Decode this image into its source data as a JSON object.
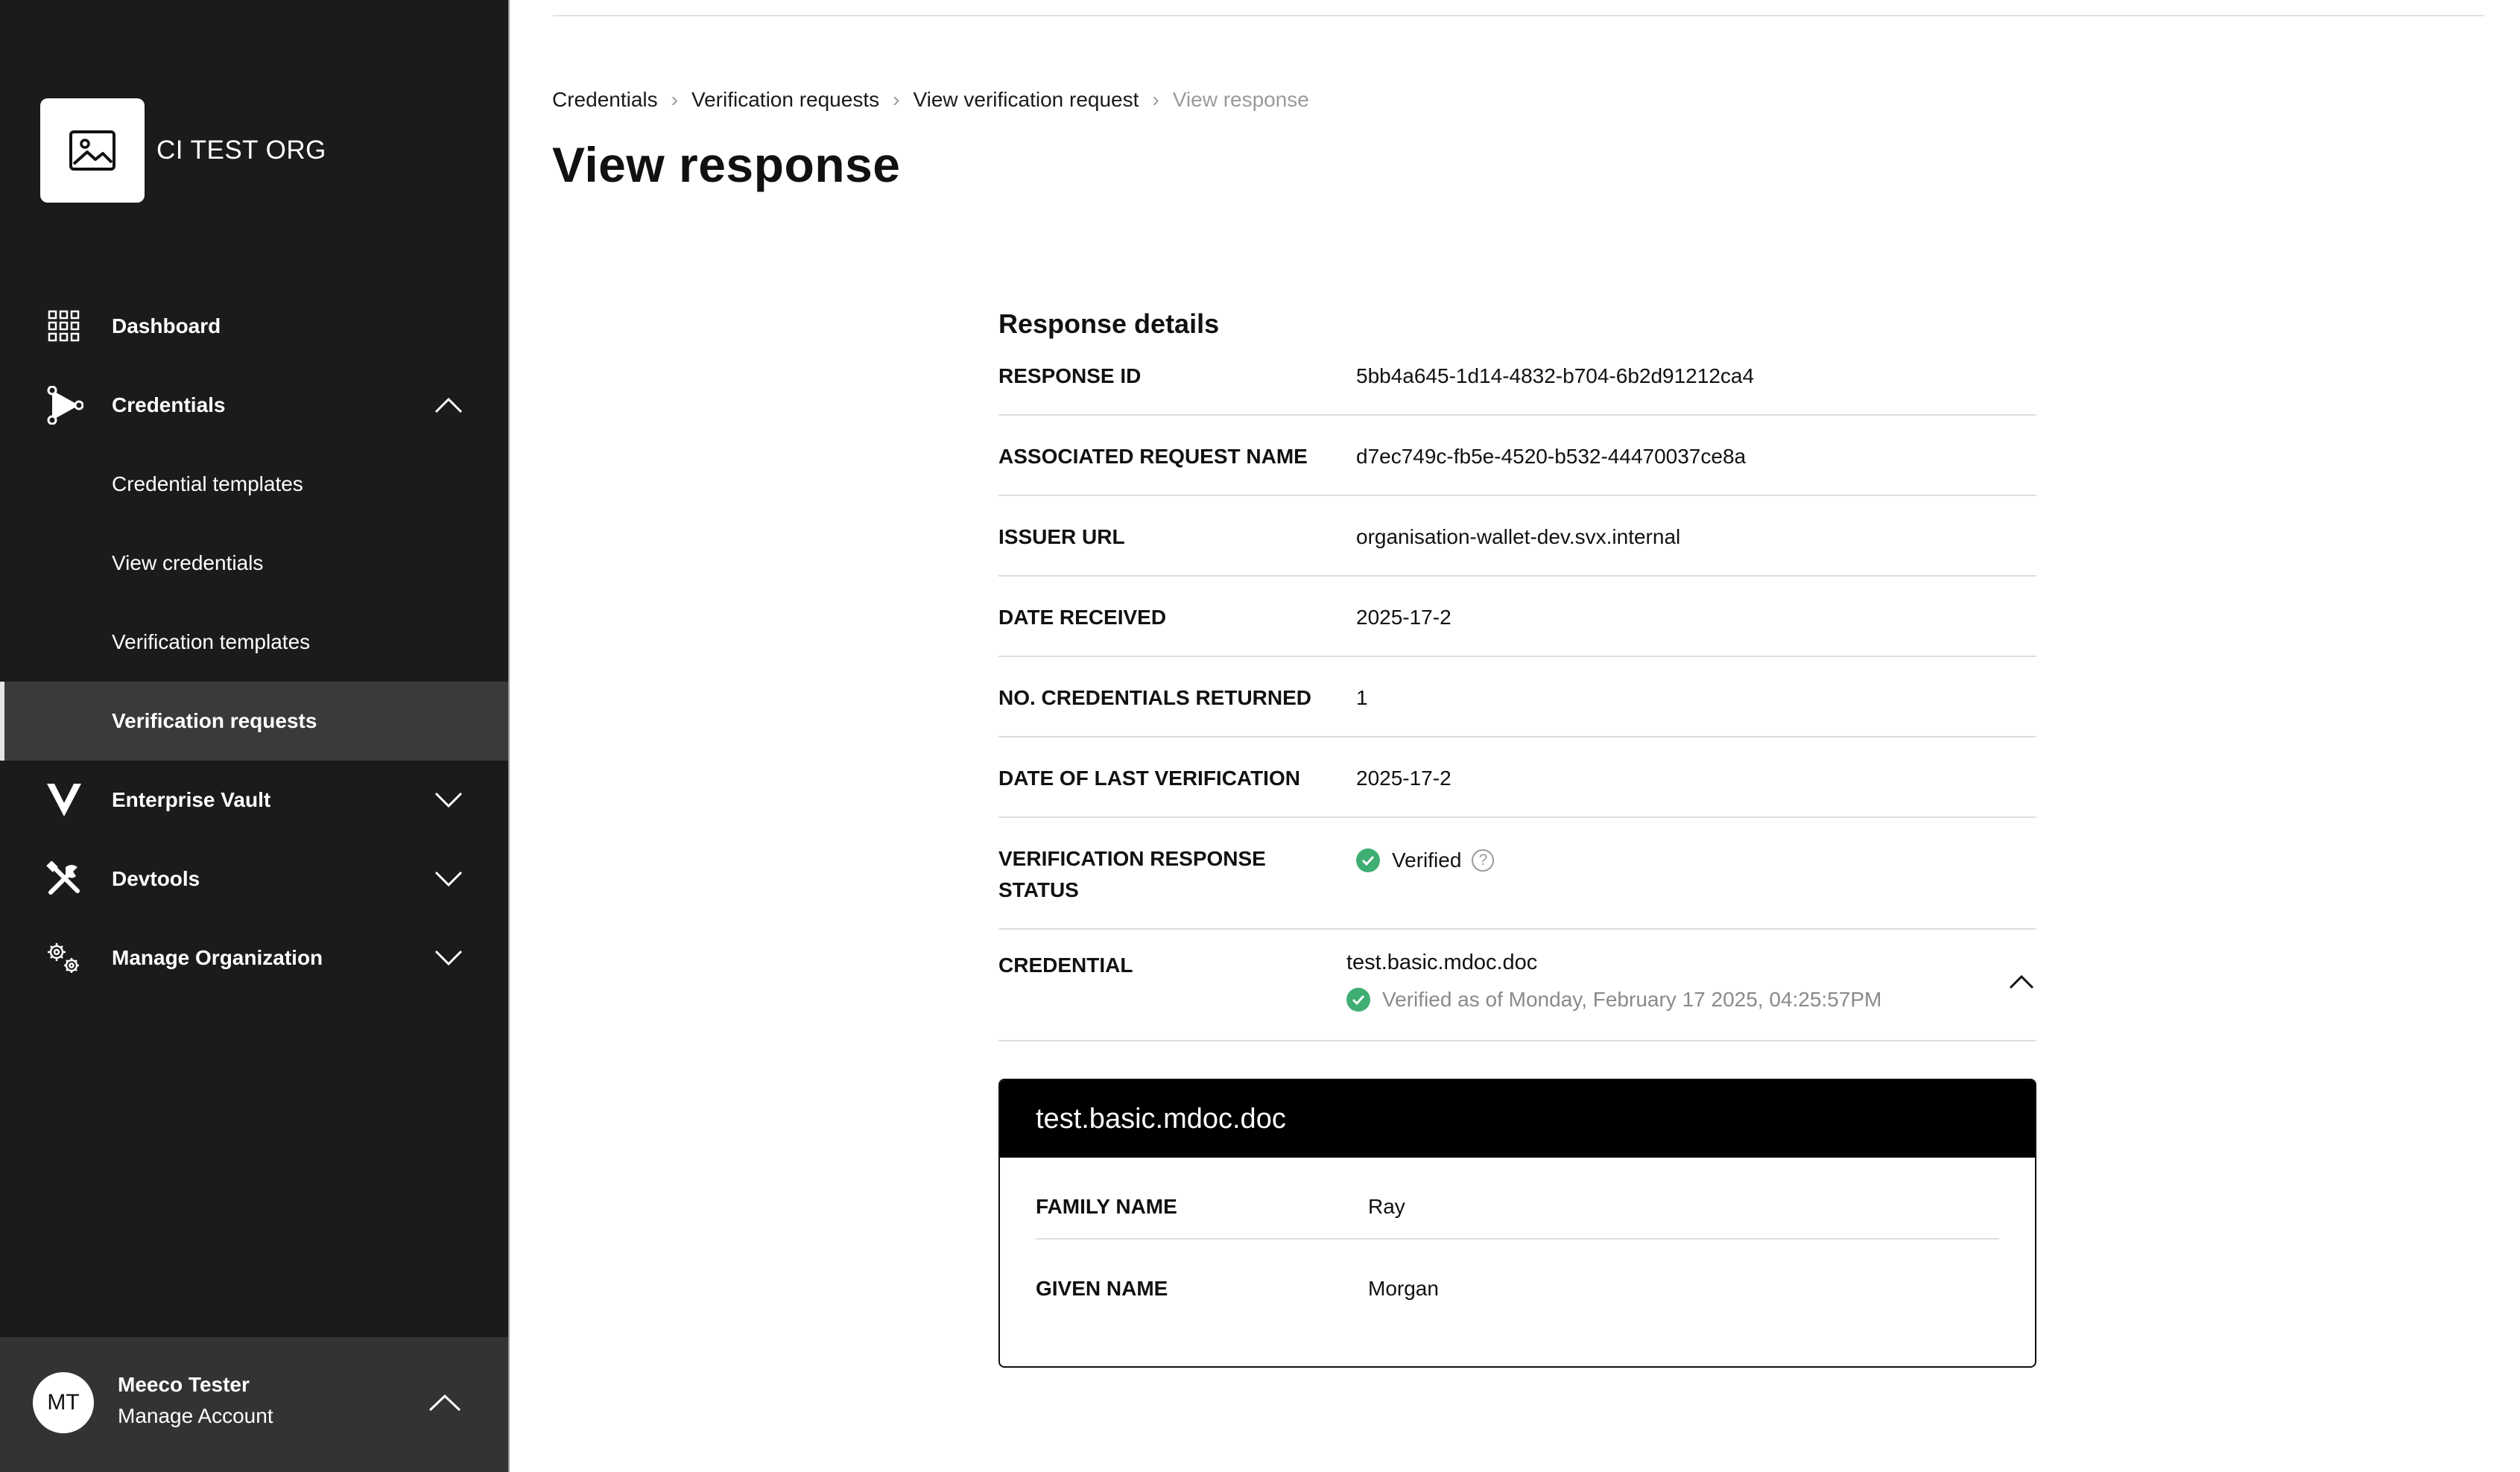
{
  "sidebar": {
    "org_name": "CI TEST ORG",
    "items": [
      {
        "label": "Dashboard",
        "icon": "grid-icon"
      },
      {
        "label": "Credentials",
        "icon": "credentials-icon"
      },
      {
        "label": "Credential templates"
      },
      {
        "label": "View credentials"
      },
      {
        "label": "Verification templates"
      },
      {
        "label": "Verification requests"
      },
      {
        "label": "Enterprise Vault",
        "icon": "vault-icon"
      },
      {
        "label": "Devtools",
        "icon": "tools-icon"
      },
      {
        "label": "Manage Organization",
        "icon": "gears-icon"
      }
    ],
    "account": {
      "initials": "MT",
      "name": "Meeco Tester",
      "manage": "Manage Account"
    }
  },
  "breadcrumb": [
    "Credentials",
    "Verification requests",
    "View verification request",
    "View response"
  ],
  "page_title": "View response",
  "details": {
    "section_title": "Response details",
    "rows": [
      {
        "key": "RESPONSE ID",
        "value": "5bb4a645-1d14-4832-b704-6b2d91212ca4"
      },
      {
        "key": "ASSOCIATED REQUEST NAME",
        "value": "d7ec749c-fb5e-4520-b532-44470037ce8a"
      },
      {
        "key": "ISSUER URL",
        "value": "organisation-wallet-dev.svx.internal"
      },
      {
        "key": "DATE RECEIVED",
        "value": "2025-17-2"
      },
      {
        "key": "NO. CREDENTIALS RETURNED",
        "value": "1"
      },
      {
        "key": "DATE OF LAST VERIFICATION",
        "value": "2025-17-2"
      }
    ],
    "status_key": "VERIFICATION RESPONSE STATUS",
    "status_value": "Verified",
    "credential_key": "CREDENTIAL",
    "credential_name": "test.basic.mdoc.doc",
    "credential_verified": "Verified as of Monday, February 17 2025, 04:25:57PM"
  },
  "card": {
    "title": "test.basic.mdoc.doc",
    "rows": [
      {
        "key": "FAMILY NAME",
        "value": "Ray"
      },
      {
        "key": "GIVEN NAME",
        "value": "Morgan"
      }
    ]
  },
  "colors": {
    "sidebar": "#1b1b1b",
    "active": "#3a3a3a",
    "verified": "#3fae73"
  }
}
